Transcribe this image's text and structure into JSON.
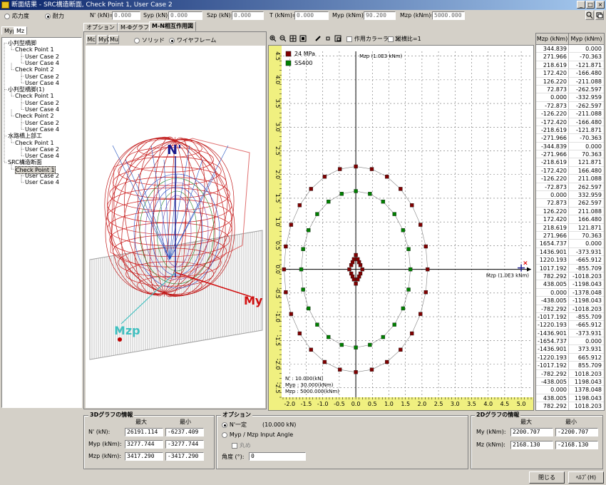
{
  "window": {
    "title": "断面結果 - SRC構造断面, Check Point 1, User Case 2",
    "controls": [
      "_",
      "□",
      "×"
    ]
  },
  "top_radios": [
    {
      "label": "応力度",
      "checked": false
    },
    {
      "label": "耐力",
      "checked": true
    }
  ],
  "fields": [
    {
      "label": "N' (kN)=",
      "value": "0.000"
    },
    {
      "label": "Syp (kN)=",
      "value": "0.000"
    },
    {
      "label": "Szp (kN)=",
      "value": "0.000"
    },
    {
      "label": "T (kNm)=",
      "value": "0.000"
    },
    {
      "label": "Myp (kNm)=",
      "value": "90.200"
    },
    {
      "label": "Mzp (kNm)=",
      "value": "5000.000"
    }
  ],
  "left_tabs": [
    "Myp",
    "Mz"
  ],
  "tree": [
    {
      "label": "小判型橋脚",
      "level": 0
    },
    {
      "label": "Check Point 1",
      "level": 1
    },
    {
      "label": "User Case 2",
      "level": 2
    },
    {
      "label": "User Case 4",
      "level": 2
    },
    {
      "label": "Check Point 2",
      "level": 1
    },
    {
      "label": "User Case 2",
      "level": 2
    },
    {
      "label": "User Case 4",
      "level": 2
    },
    {
      "label": "小判型橋脚(1)",
      "level": 0
    },
    {
      "label": "Check Point 1",
      "level": 1
    },
    {
      "label": "User Case 2",
      "level": 2
    },
    {
      "label": "User Case 4",
      "level": 2
    },
    {
      "label": "Check Point 2",
      "level": 1
    },
    {
      "label": "User Case 2",
      "level": 2
    },
    {
      "label": "User Case 4",
      "level": 2
    },
    {
      "label": "水路橋上部工",
      "level": 0
    },
    {
      "label": "Check Point 1",
      "level": 1
    },
    {
      "label": "User Case 2",
      "level": 2
    },
    {
      "label": "User Case 4",
      "level": 2
    },
    {
      "label": "SRC構造断面",
      "level": 0
    },
    {
      "label": "Check Point 1",
      "level": 1,
      "selected": true
    },
    {
      "label": "User Case 2",
      "level": 2
    },
    {
      "label": "User Case 4",
      "level": 2
    }
  ],
  "main_tabs": [
    {
      "label": "オプション",
      "active": false
    },
    {
      "label": "M-Φグラフ",
      "active": false
    },
    {
      "label": "M-N相互作用図",
      "active": true
    }
  ],
  "view3d": {
    "buttons": [
      "Mc",
      "My0",
      "Mu"
    ],
    "radios": [
      {
        "label": "ソリッド",
        "checked": false
      },
      {
        "label": "ワイヤフレーム",
        "checked": true
      }
    ],
    "axis_labels": {
      "n": "N'",
      "my": "My",
      "mzp": "Mzp"
    }
  },
  "toolbar2d": {
    "icons": [
      "zoom-in-icon",
      "zoom-out-icon",
      "fit-icon",
      "frame-icon",
      "pen-icon",
      "square-icon",
      "box-icon"
    ],
    "check_action_line": "作用カラーライン",
    "check_ratio": "縦横比=1"
  },
  "chart_data": {
    "type": "scatter",
    "title": "",
    "xlabel": "Mzp (1.0E3 kNm)",
    "ylabel": "Mzp (1.0E3 kNm)",
    "xlim": [
      -2.2,
      5.3
    ],
    "ylim": [
      -2.7,
      4.6
    ],
    "xticks": [
      "-2.0",
      "-1.5",
      "-1.0",
      "-0.5",
      "0.0",
      "0.5",
      "1.0",
      "1.5",
      "2.0",
      "2.5",
      "3.0",
      "3.5",
      "4.0",
      "4.5",
      "5.0"
    ],
    "yticks": [
      "-2.5",
      "-2.0",
      "-1.5",
      "-1.0",
      "-0.5",
      "0.0",
      "0.5",
      "1.0",
      "1.5",
      "2.0",
      "2.5",
      "3.0",
      "3.5",
      "4.0",
      "4.5"
    ],
    "grid": true,
    "legend_position": "top-left",
    "series": [
      {
        "name": "24 MPa",
        "color": "#800000",
        "rings": [
          [
            2.17,
            2.17
          ],
          [
            0.14,
            0.27
          ]
        ]
      },
      {
        "name": "SS400",
        "color": "#008000",
        "rings": [
          [
            1.65,
            1.65
          ]
        ]
      }
    ],
    "action_point": {
      "x": 5.0,
      "y": 0.09
    },
    "info": [
      "N' : 10.000(kN)",
      "Myp : 30.000(kNm)",
      "Mzp : 5000.000(kNm)"
    ]
  },
  "table": {
    "headers": [
      "Mzp (kNm)",
      "Myp (kNm)"
    ],
    "rows": [
      [
        "344.839",
        "0.000"
      ],
      [
        "271.966",
        "-70.363"
      ],
      [
        "218.619",
        "-121.871"
      ],
      [
        "172.420",
        "-166.480"
      ],
      [
        "126.220",
        "-211.088"
      ],
      [
        "72.873",
        "-262.597"
      ],
      [
        "0.000",
        "-332.959"
      ],
      [
        "-72.873",
        "-262.597"
      ],
      [
        "-126.220",
        "-211.088"
      ],
      [
        "-172.420",
        "-166.480"
      ],
      [
        "-218.619",
        "-121.871"
      ],
      [
        "-271.966",
        "-70.363"
      ],
      [
        "-344.839",
        "0.000"
      ],
      [
        "-271.966",
        "70.363"
      ],
      [
        "-218.619",
        "121.871"
      ],
      [
        "-172.420",
        "166.480"
      ],
      [
        "-126.220",
        "211.088"
      ],
      [
        "-72.873",
        "262.597"
      ],
      [
        "0.000",
        "332.959"
      ],
      [
        "72.873",
        "262.597"
      ],
      [
        "126.220",
        "211.088"
      ],
      [
        "172.420",
        "166.480"
      ],
      [
        "218.619",
        "121.871"
      ],
      [
        "271.966",
        "70.363"
      ],
      [
        "1654.737",
        "0.000"
      ],
      [
        "1436.901",
        "-373.931"
      ],
      [
        "1220.193",
        "-665.912"
      ],
      [
        "1017.192",
        "-855.709"
      ],
      [
        "782.292",
        "-1018.203"
      ],
      [
        "438.005",
        "-1198.043"
      ],
      [
        "0.000",
        "-1378.048"
      ],
      [
        "-438.005",
        "-1198.043"
      ],
      [
        "-782.292",
        "-1018.203"
      ],
      [
        "-1017.192",
        "-855.709"
      ],
      [
        "-1220.193",
        "-665.912"
      ],
      [
        "-1436.901",
        "-373.931"
      ],
      [
        "-1654.737",
        "0.000"
      ],
      [
        "-1436.901",
        "373.931"
      ],
      [
        "-1220.193",
        "665.912"
      ],
      [
        "-1017.192",
        "855.709"
      ],
      [
        "-782.292",
        "1018.203"
      ],
      [
        "-438.005",
        "1198.043"
      ],
      [
        "0.000",
        "1378.048"
      ],
      [
        "438.005",
        "1198.043"
      ],
      [
        "782.292",
        "1018.203"
      ]
    ]
  },
  "info3d": {
    "title": "3Dグラフの情報",
    "col_max": "最大",
    "col_min": "最小",
    "rows": [
      {
        "label": "N' (kN):",
        "max": "26191.114",
        "min": "-6237.409"
      },
      {
        "label": "Myp (kNm):",
        "max": "3277.744",
        "min": "-3277.744"
      },
      {
        "label": "Mzp (kNm):",
        "max": "3417.290",
        "min": "-3417.290"
      }
    ]
  },
  "options": {
    "title": "オプション",
    "radio1": "N'一定",
    "radio1_value": "(10.000 kN)",
    "radio2": "Myp / Mzp Input Angle",
    "check": "丸め",
    "angle_label": "角度 (°):",
    "angle_value": "0"
  },
  "info2d": {
    "title": "2Dグラフの情報",
    "col_max": "最大",
    "col_min": "最小",
    "rows": [
      {
        "label": "My (kNm):",
        "max": "2200.707",
        "min": "-2200.707"
      },
      {
        "label": "Mz (kNm):",
        "max": "2168.130",
        "min": "-2168.130"
      }
    ]
  },
  "buttons": {
    "close": "閉じる",
    "help": "ﾍﾙﾌﾟ(H)"
  }
}
